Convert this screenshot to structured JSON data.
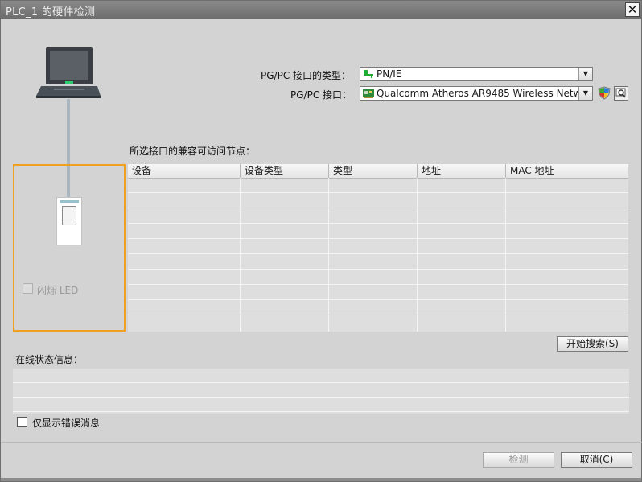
{
  "window": {
    "title": "PLC_1 的硬件检测"
  },
  "interface_type": {
    "label": "PG/PC 接口的类型：",
    "value": "PN/IE"
  },
  "interface": {
    "label": "PG/PC 接口：",
    "value": "Qualcomm Atheros AR9485 Wireless Networ..."
  },
  "nodes": {
    "label": "所选接口的兼容可访问节点：",
    "columns": [
      "设备",
      "设备类型",
      "类型",
      "地址",
      "MAC 地址"
    ]
  },
  "flash_led": {
    "label": "闪烁 LED"
  },
  "search_button": {
    "label": "开始搜索(S)"
  },
  "online_status": {
    "label": "在线状态信息："
  },
  "errors_only": {
    "label": "仅显示错误消息"
  },
  "detect_button": {
    "label": "检测"
  },
  "cancel_button": {
    "label": "取消(C)"
  },
  "colors": {
    "accent": "#f0a020",
    "titlebar": "#7a7a7a",
    "background": "#d3d3d3"
  }
}
